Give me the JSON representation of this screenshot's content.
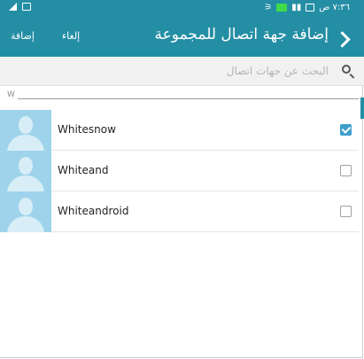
{
  "status_bar": {
    "time": "٧:٣٦ ص"
  },
  "app_bar": {
    "title": "إضافة جهة اتصال للمجموعة",
    "add_label": "إضافة",
    "cancel_label": "إلغاء"
  },
  "search": {
    "placeholder": "البحث عن جهات اتصال"
  },
  "section": {
    "header": "W"
  },
  "contacts": [
    {
      "name": "Whitesnow",
      "checked": true
    },
    {
      "name": "Whiteand",
      "checked": false
    },
    {
      "name": "Whiteandroid",
      "checked": false
    }
  ],
  "colors": {
    "accent": "#248ea5",
    "checkbox": "#3f9fcb",
    "avatar_bg": "#9fd3ec"
  }
}
